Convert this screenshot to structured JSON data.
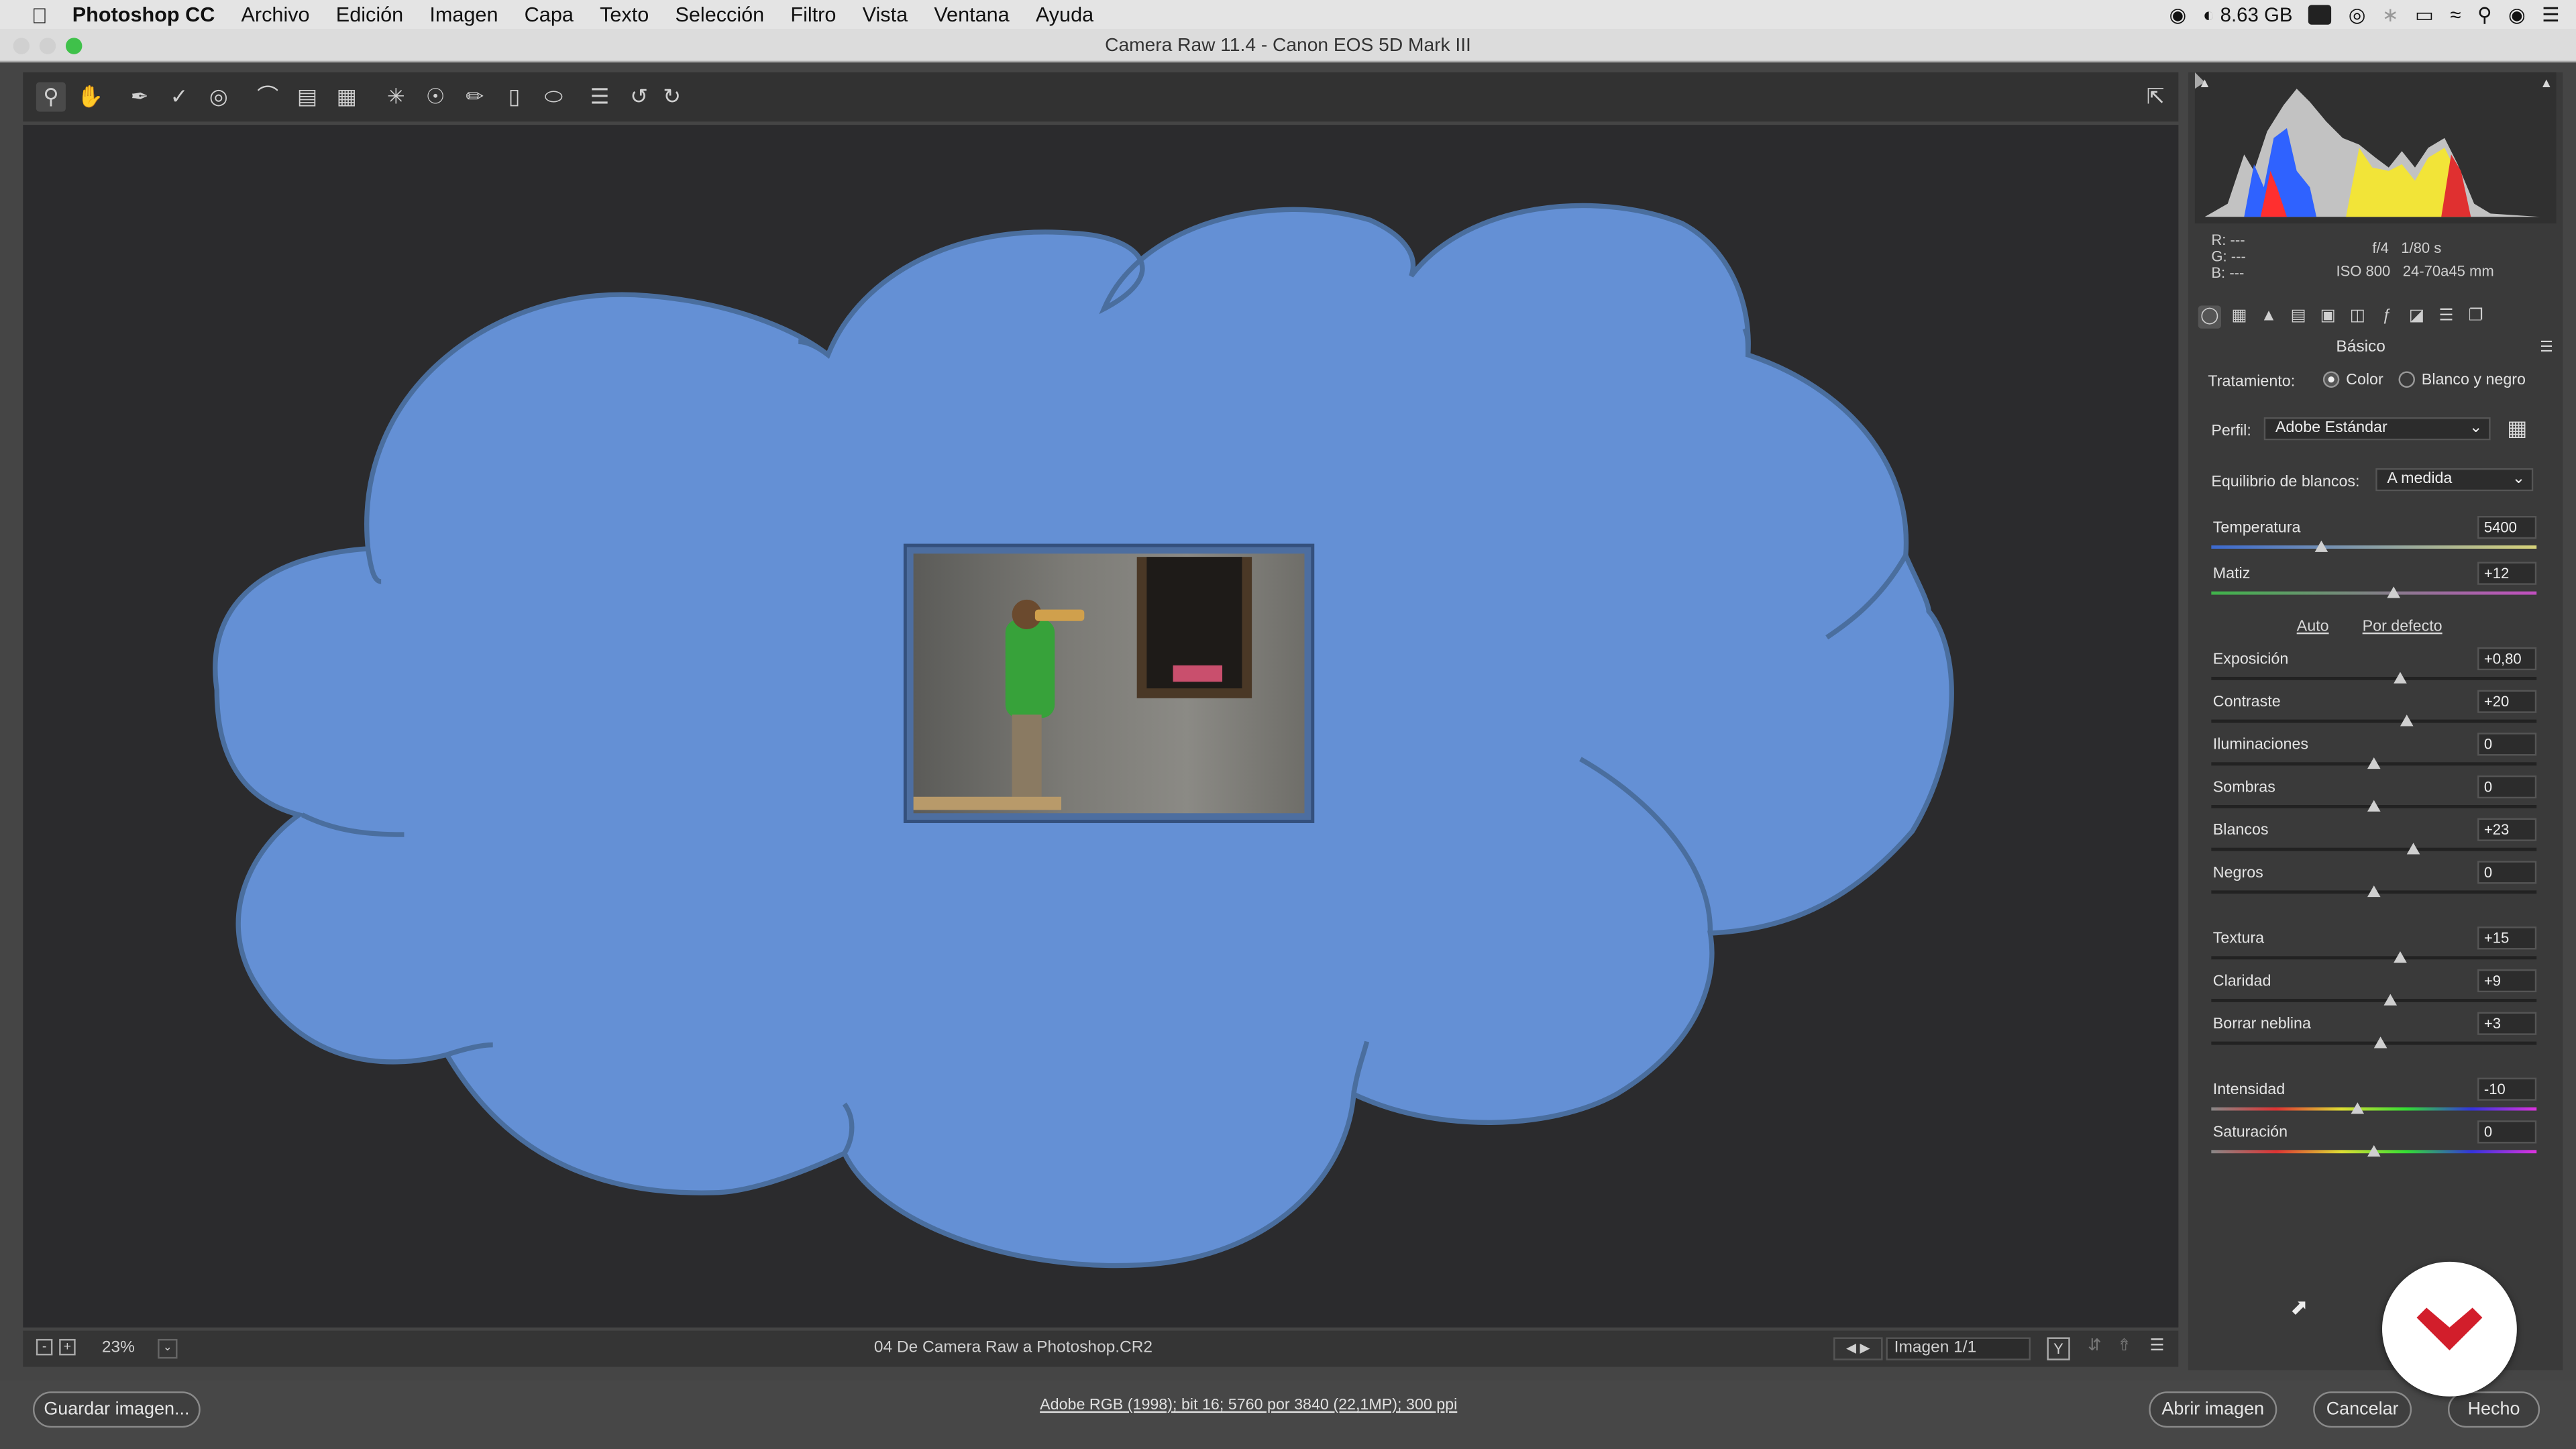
{
  "menubar": {
    "app": "Photoshop CC",
    "items": [
      "Archivo",
      "Edición",
      "Imagen",
      "Capa",
      "Texto",
      "Selección",
      "Filtro",
      "Vista",
      "Ventana",
      "Ayuda"
    ],
    "memory": "8.63 GB"
  },
  "window": {
    "title": "Camera Raw 11.4 -  Canon EOS 5D Mark III"
  },
  "status": {
    "zoom": "23%",
    "filename": "04 De Camera Raw a Photoshop.CR2",
    "image_counter": "Imagen 1/1"
  },
  "footer": {
    "save_label": "Guardar imagen...",
    "workflow_info": "Adobe RGB (1998); bit 16; 5760 por 3840 (22,1MP); 300 ppi",
    "open_label": "Abrir imagen",
    "cancel_label": "Cancelar",
    "done_label": "Hecho"
  },
  "info": {
    "r": "R:",
    "g": "G:",
    "b": "B:",
    "r_val": "---",
    "g_val": "---",
    "b_val": "---",
    "aperture": "f/4",
    "shutter": "1/80 s",
    "iso": "ISO 800",
    "lens": "24-70a45 mm"
  },
  "panel": {
    "title": "Básico",
    "treatment_label": "Tratamiento:",
    "treatment_color": "Color",
    "treatment_bw": "Blanco y negro",
    "treatment_selected": "Color",
    "profile_label": "Perfil:",
    "profile_value": "Adobe Estándar",
    "wb_label": "Equilibrio de blancos:",
    "wb_value": "A medida",
    "auto": "Auto",
    "default": "Por defecto",
    "sliders": [
      {
        "name": "Temperatura",
        "value": "5400",
        "pos": 0.34,
        "kind": "temp"
      },
      {
        "name": "Matiz",
        "value": "+12",
        "pos": 0.56,
        "kind": "tint"
      },
      {
        "name": "Exposición",
        "value": "+0,80",
        "pos": 0.58,
        "kind": "plain"
      },
      {
        "name": "Contraste",
        "value": "+20",
        "pos": 0.6,
        "kind": "plain"
      },
      {
        "name": "Iluminaciones",
        "value": "0",
        "pos": 0.5,
        "kind": "plain"
      },
      {
        "name": "Sombras",
        "value": "0",
        "pos": 0.5,
        "kind": "plain"
      },
      {
        "name": "Blancos",
        "value": "+23",
        "pos": 0.62,
        "kind": "plain"
      },
      {
        "name": "Negros",
        "value": "0",
        "pos": 0.5,
        "kind": "plain"
      },
      {
        "name": "Textura",
        "value": "+15",
        "pos": 0.58,
        "kind": "plain"
      },
      {
        "name": "Claridad",
        "value": "+9",
        "pos": 0.55,
        "kind": "plain"
      },
      {
        "name": "Borrar neblina",
        "value": "+3",
        "pos": 0.52,
        "kind": "plain"
      },
      {
        "name": "Intensidad",
        "value": "-10",
        "pos": 0.45,
        "kind": "sat"
      },
      {
        "name": "Saturación",
        "value": "0",
        "pos": 0.5,
        "kind": "sat"
      }
    ]
  },
  "colors": {
    "cloud_fill": "#6490d5",
    "cloud_stroke": "#4a6e9e",
    "brand_red": "#d21e2b"
  }
}
